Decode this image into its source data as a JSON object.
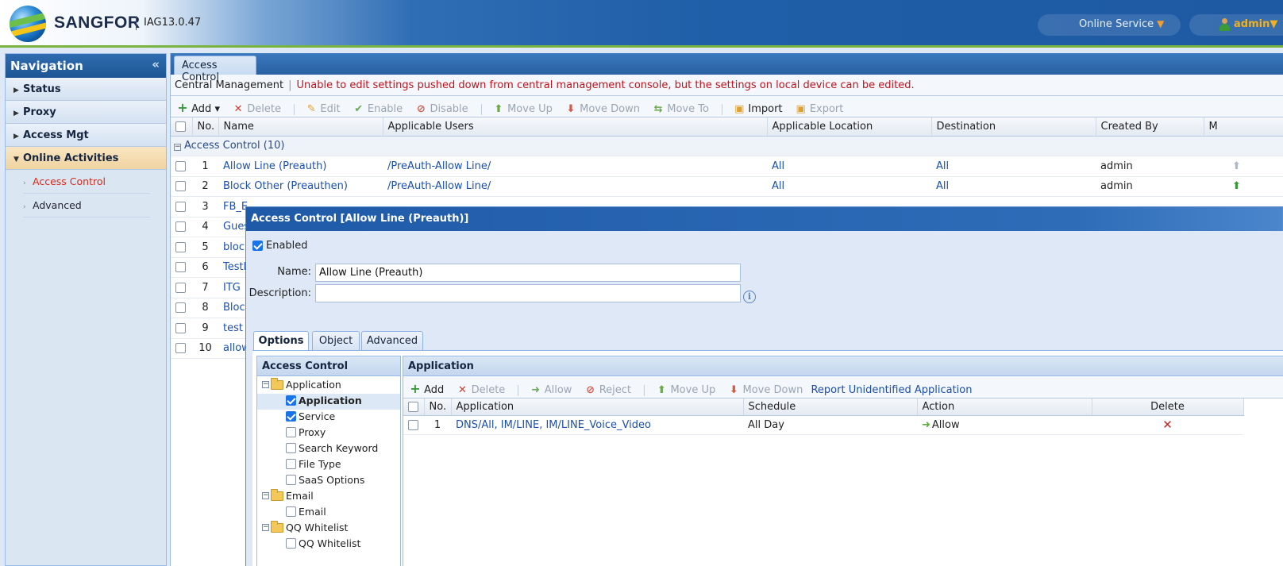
{
  "header": {
    "brand": "SANGFOR",
    "version": "IAG13.0.47",
    "online_service": "Online Service",
    "online_service_caret": "▼",
    "user": "admin",
    "user_caret": "▼"
  },
  "nav": {
    "title": "Navigation",
    "collapse": "«",
    "items": [
      {
        "label": "Status",
        "arrow": "▶"
      },
      {
        "label": "Proxy",
        "arrow": "▶"
      },
      {
        "label": "Access Mgt",
        "arrow": "▶"
      },
      {
        "label": "Online Activities",
        "arrow": "▼"
      }
    ],
    "subitems": [
      {
        "label": "Access Control",
        "arrow": "›"
      },
      {
        "label": "Advanced",
        "arrow": "›"
      }
    ]
  },
  "main": {
    "tab": "Access Control",
    "cm_label": "Central Management",
    "cm_sep": "|",
    "cm_warning": "Unable to edit settings pushed down from central management console, but the settings on local device can be edited.",
    "toolbar": {
      "add": "Add",
      "add_caret": "▾",
      "delete": "Delete",
      "edit": "Edit",
      "enable": "Enable",
      "disable": "Disable",
      "move_up": "Move Up",
      "move_down": "Move Down",
      "move_to": "Move To",
      "import": "Import",
      "export": "Export"
    },
    "columns": [
      "No.",
      "Name",
      "Applicable Users",
      "Applicable Location",
      "Destination",
      "Created By",
      "M"
    ],
    "group_label": "Access Control (10)",
    "rows": [
      {
        "no": "1",
        "name": "Allow Line (Preauth)",
        "users": "/PreAuth-Allow Line/",
        "location": "All",
        "destination": "All",
        "created_by": "admin"
      },
      {
        "no": "2",
        "name": "Block Other (Preauthen)",
        "users": "/PreAuth-Allow Line/",
        "location": "All",
        "destination": "All",
        "created_by": "admin"
      },
      {
        "no": "3",
        "name": "FB_E"
      },
      {
        "no": "4",
        "name": "Gues"
      },
      {
        "no": "5",
        "name": "block"
      },
      {
        "no": "6",
        "name": "TestF"
      },
      {
        "no": "7",
        "name": "ITG"
      },
      {
        "no": "8",
        "name": "Block"
      },
      {
        "no": "9",
        "name": "test"
      },
      {
        "no": "10",
        "name": "allow"
      }
    ]
  },
  "dialog": {
    "title": "Access Control [Allow Line (Preauth)]",
    "enabled_label": "Enabled",
    "enabled": true,
    "name_label": "Name:",
    "name_value": "Allow Line (Preauth)",
    "description_label": "Description:",
    "description_value": "",
    "info": "i",
    "tabs": [
      "Options",
      "Object",
      "Advanced"
    ],
    "tree": {
      "title": "Access Control",
      "nodes": [
        {
          "type": "parent",
          "label": "Application"
        },
        {
          "type": "child",
          "label": "Application",
          "checked": true,
          "selected": true
        },
        {
          "type": "child",
          "label": "Service",
          "checked": true
        },
        {
          "type": "child",
          "label": "Proxy",
          "checked": false
        },
        {
          "type": "child",
          "label": "Search Keyword",
          "checked": false
        },
        {
          "type": "child",
          "label": "File Type",
          "checked": false
        },
        {
          "type": "child",
          "label": "SaaS Options",
          "checked": false
        },
        {
          "type": "parent",
          "label": "Email"
        },
        {
          "type": "child",
          "label": "Email",
          "checked": false
        },
        {
          "type": "parent",
          "label": "QQ Whitelist"
        },
        {
          "type": "child",
          "label": "QQ Whitelist",
          "checked": false
        }
      ]
    },
    "app_panel": {
      "title": "Application",
      "toolbar": {
        "add": "Add",
        "delete": "Delete",
        "allow": "Allow",
        "reject": "Reject",
        "move_up": "Move Up",
        "move_down": "Move Down",
        "report": "Report Unidentified Application"
      },
      "columns": [
        "No.",
        "Application",
        "Schedule",
        "Action",
        "Delete"
      ],
      "rows": [
        {
          "no": "1",
          "application": "DNS/All, IM/LINE, IM/LINE_Voice_Video",
          "schedule": "All Day",
          "action": "Allow",
          "delete": "✕"
        }
      ]
    }
  },
  "colors": {
    "header_blue": "#1f5ea8",
    "accent_green": "#7ab440",
    "warning_red": "#c0121a",
    "link_blue": "#1a4fb0",
    "admin_orange": "#f0b020"
  }
}
